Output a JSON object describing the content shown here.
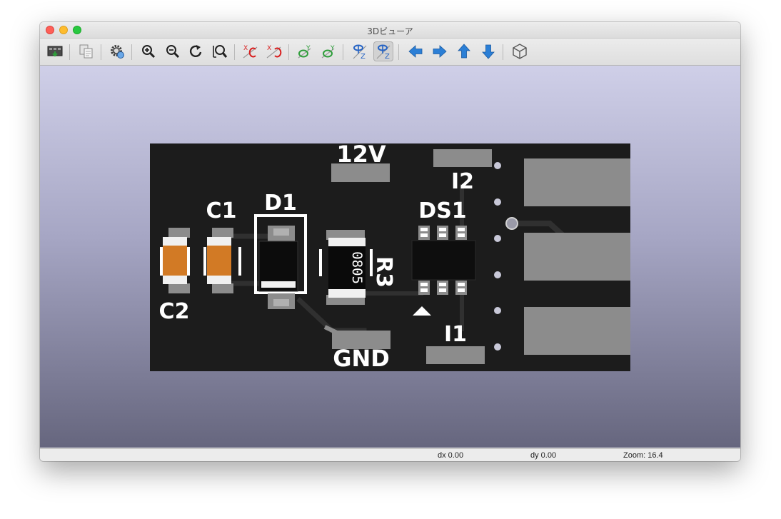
{
  "window": {
    "title": "3Dビューア"
  },
  "toolbar": {
    "buttons": [
      {
        "name": "reload-board-button",
        "icon": "board-reload-icon"
      },
      {
        "name": "copy-to-clipboard-button",
        "icon": "copy-icon"
      },
      {
        "name": "options-button",
        "icon": "gear-icon"
      },
      {
        "name": "zoom-in-button",
        "icon": "zoom-in-icon"
      },
      {
        "name": "zoom-out-button",
        "icon": "zoom-out-icon"
      },
      {
        "name": "redraw-button",
        "icon": "redraw-icon"
      },
      {
        "name": "zoom-fit-button",
        "icon": "zoom-fit-icon"
      },
      {
        "name": "rotate-x-cw-button",
        "icon": "rotate-x-icon"
      },
      {
        "name": "rotate-x-ccw-button",
        "icon": "rotate-x-icon"
      },
      {
        "name": "rotate-y-cw-button",
        "icon": "rotate-y-icon"
      },
      {
        "name": "rotate-y-ccw-button",
        "icon": "rotate-y-icon"
      },
      {
        "name": "rotate-z-cw-button",
        "icon": "rotate-z-icon"
      },
      {
        "name": "rotate-z-ccw-button",
        "icon": "rotate-z-icon"
      },
      {
        "name": "pan-left-button",
        "icon": "arrow-left-icon"
      },
      {
        "name": "pan-right-button",
        "icon": "arrow-right-icon"
      },
      {
        "name": "pan-up-button",
        "icon": "arrow-up-icon"
      },
      {
        "name": "pan-down-button",
        "icon": "arrow-down-icon"
      },
      {
        "name": "orthographic-toggle-button",
        "icon": "cube-icon"
      }
    ],
    "axis_letters": {
      "x": "X",
      "y": "Y",
      "z": "Z"
    }
  },
  "board": {
    "colors": {
      "substrate": "#1c1c1c",
      "copper": "#8c8c8c",
      "trace": "#303030",
      "silkscreen": "#ffffff",
      "capacitor_body": "#d27a25"
    },
    "labels": {
      "net_12v": "12V",
      "net_gnd": "GND",
      "c1": "C1",
      "c2": "C2",
      "d1": "D1",
      "ds1": "DS1",
      "r3": "R3",
      "r3_body": "0805",
      "i1": "I1",
      "i2": "I2"
    }
  },
  "status": {
    "dx": "dx 0.00",
    "dy": "dy 0.00",
    "zoom": "Zoom: 16.4"
  }
}
